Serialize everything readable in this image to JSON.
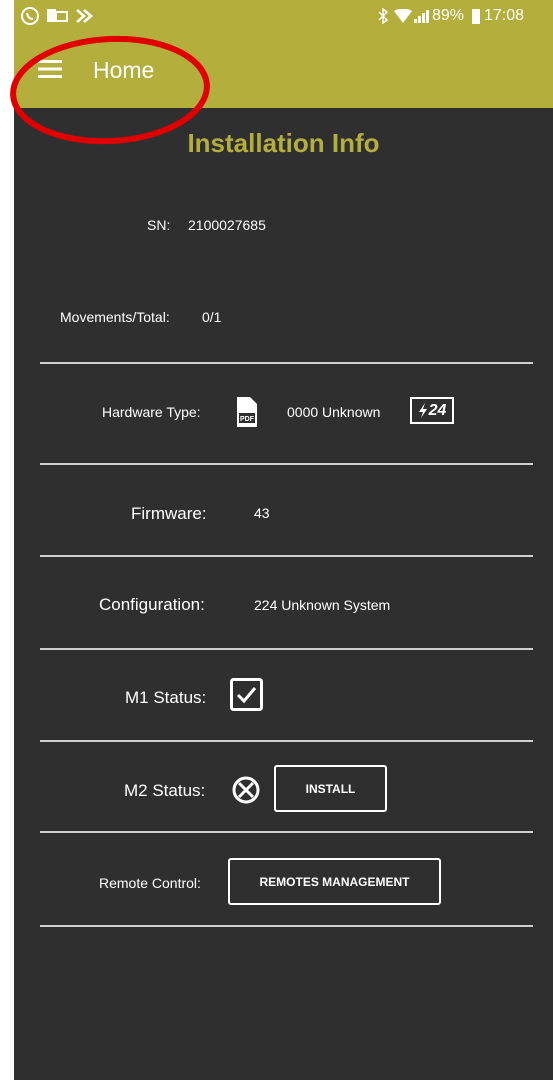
{
  "statusbar": {
    "battery": "89%",
    "time": "17:08"
  },
  "appbar": {
    "title": "Home"
  },
  "page": {
    "title": "Installation Info"
  },
  "info": {
    "sn_label": "SN:",
    "sn_value": "2100027685",
    "movements_label": "Movements/Total:",
    "movements_value": "0/1",
    "hardware_label": "Hardware Type:",
    "hardware_value": "0000 Unknown",
    "hardware_badge": "24",
    "firmware_label": "Firmware:",
    "firmware_value": "43",
    "configuration_label": "Configuration:",
    "configuration_value": "224 Unknown System",
    "m1_label": "M1 Status:",
    "m2_label": "M2 Status:",
    "install_button": "INSTALL",
    "remote_label": "Remote Control:",
    "remotes_button": "REMOTES MANAGEMENT"
  },
  "colors": {
    "accent": "#b4ae3d",
    "background": "#2f2f2f",
    "annotation": "#e00000"
  },
  "icons": [
    "whatsapp-icon",
    "outlook-icon",
    "notification-icon",
    "bluetooth-icon",
    "wifi-icon",
    "signal-icon",
    "battery-icon",
    "menu-icon",
    "pdf-icon",
    "bolt-icon",
    "checked-icon",
    "error-icon"
  ]
}
